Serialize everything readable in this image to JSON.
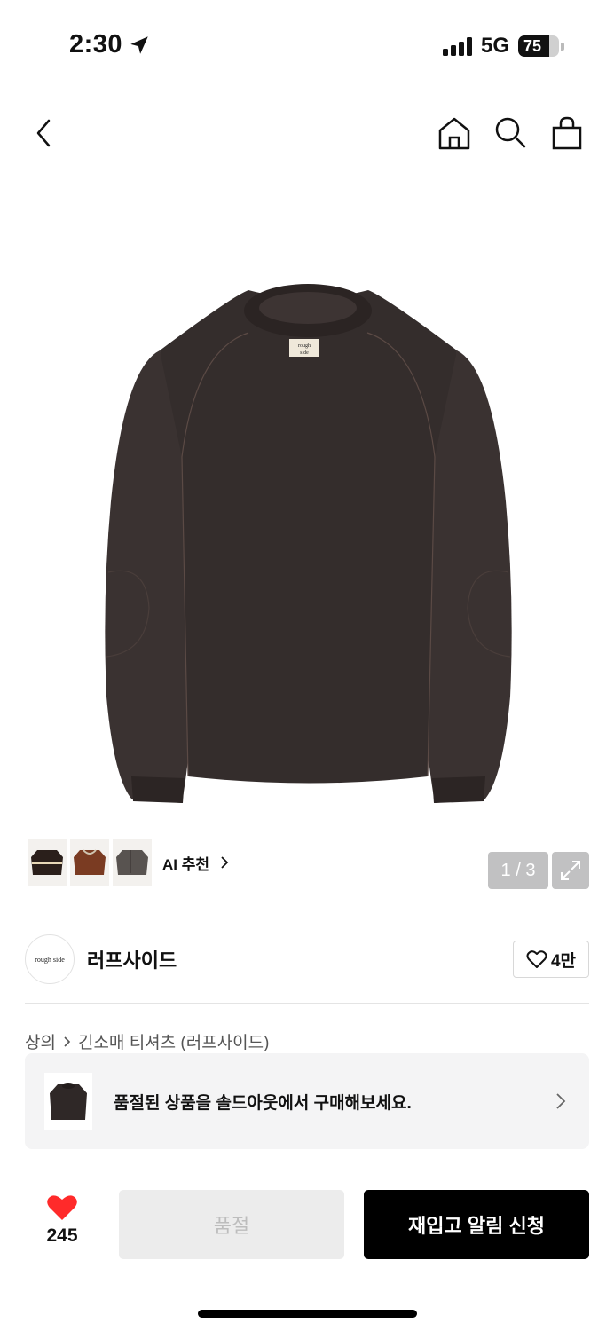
{
  "status_bar": {
    "time": "2:30",
    "network": "5G",
    "battery": "75",
    "battery_level": 0.75
  },
  "nav": {
    "back_icon": "chevron-left-icon",
    "home_icon": "home-icon",
    "search_icon": "search-icon",
    "bag_icon": "shopping-bag-icon"
  },
  "gallery": {
    "counter": "1 / 3",
    "ai_recommend_label": "AI 추천",
    "sweater_label_top": "rough",
    "sweater_label_bottom": "side"
  },
  "brand": {
    "logo_text": "rough side",
    "name": "러프사이드",
    "like_count": "4만"
  },
  "breadcrumb": {
    "category": "상의",
    "subcategory": "긴소매 티셔츠 (러프사이드)"
  },
  "soldout_banner": {
    "text": "품절된 상품을 솔드아웃에서 구매해보세요."
  },
  "bottom_bar": {
    "like_count": "245",
    "soldout_label": "품절",
    "restock_label": "재입고 알림 신청"
  },
  "colors": {
    "accent_heart": "#ff2a2a",
    "button_primary": "#000000",
    "button_disabled": "#ececec"
  }
}
